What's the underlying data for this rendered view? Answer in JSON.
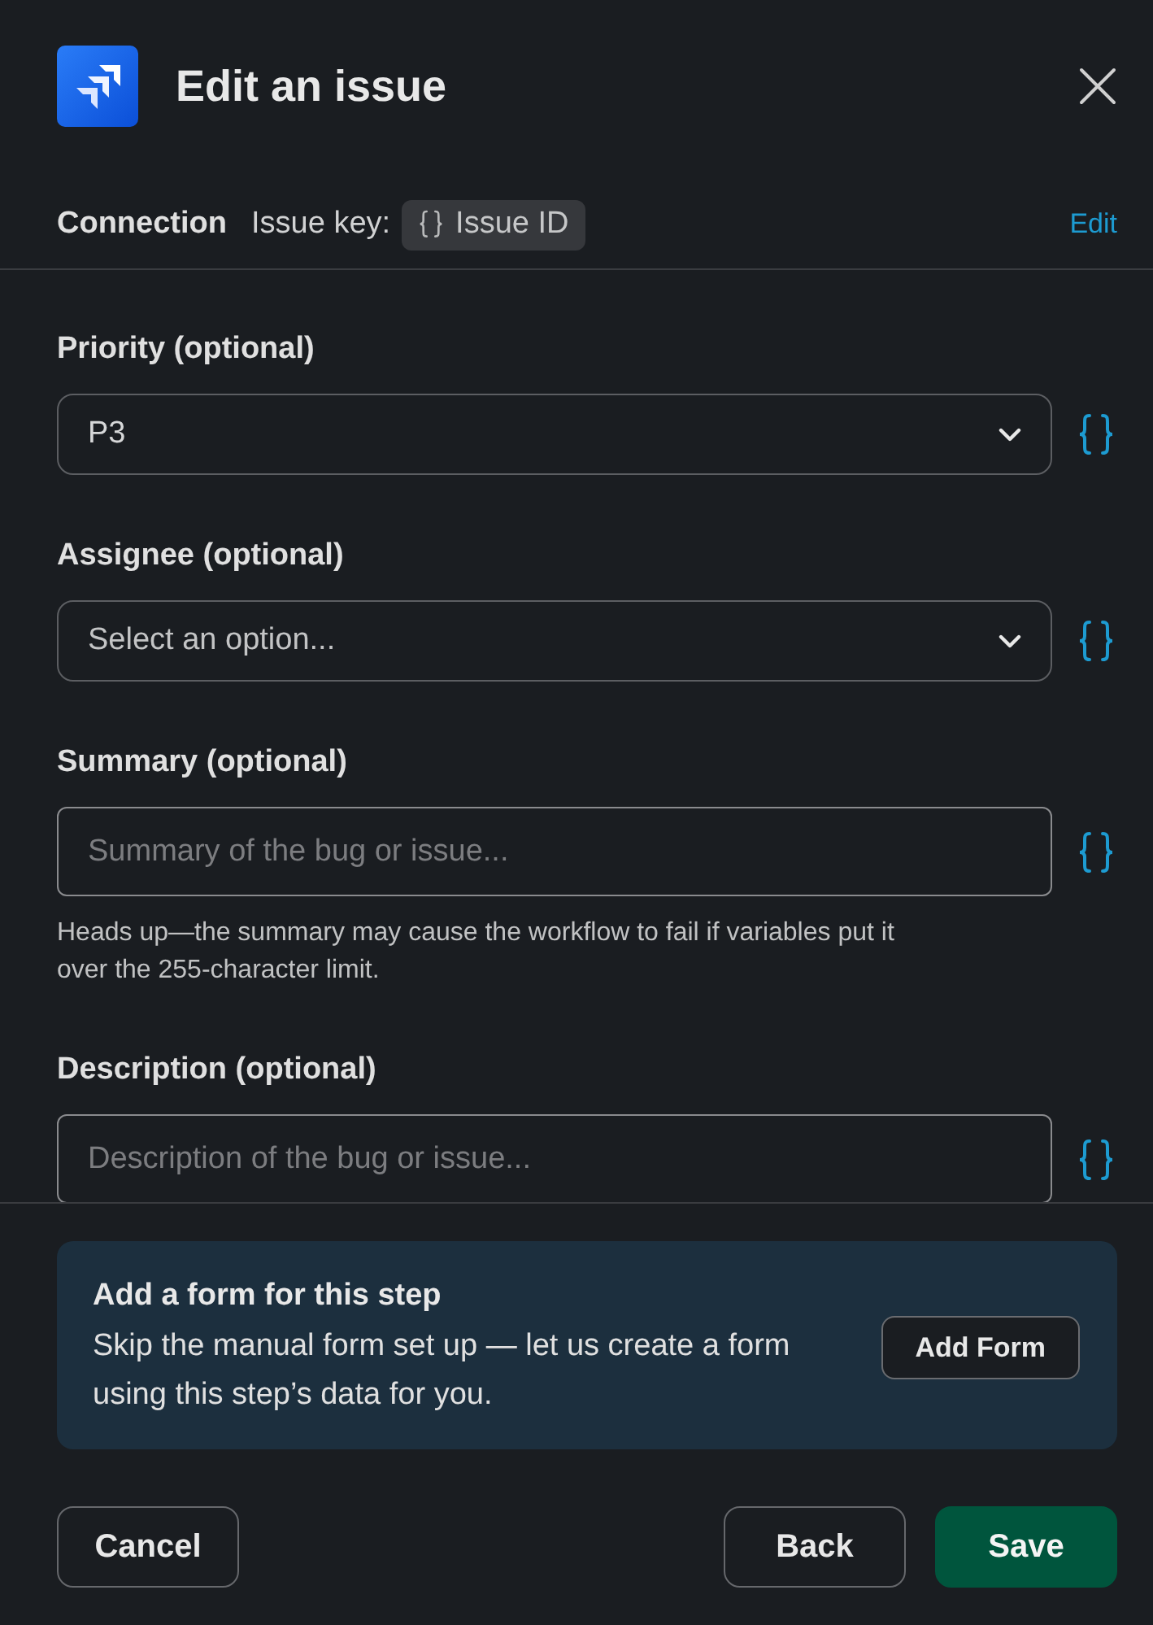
{
  "header": {
    "title": "Edit an issue"
  },
  "connection": {
    "label": "Connection",
    "key_label": "Issue key:",
    "key_value": "Issue ID",
    "action": "Edit"
  },
  "fields": [
    {
      "kind": "select",
      "label": "Priority (optional)",
      "value": "P3"
    },
    {
      "kind": "select",
      "label": "Assignee (optional)",
      "placeholder": "Select an option..."
    },
    {
      "kind": "text",
      "label": "Summary (optional)",
      "placeholder": "Summary of the bug or issue...",
      "help": "Heads up—the summary may cause the workflow to fail if variables put it over the 255-character limit."
    },
    {
      "kind": "text",
      "label": "Description (optional)",
      "placeholder": "Description of the bug or issue..."
    }
  ],
  "form_prompt": {
    "title": "Add a form for this step",
    "text": "Skip the manual form set up — let us create a form using this step’s data for you.",
    "button": "Add Form"
  },
  "footer": {
    "start": [
      {
        "label": "Cancel",
        "kind": "secondary"
      }
    ],
    "end": [
      {
        "label": "Back",
        "kind": "secondary"
      },
      {
        "label": "Save",
        "kind": "primary"
      }
    ]
  }
}
